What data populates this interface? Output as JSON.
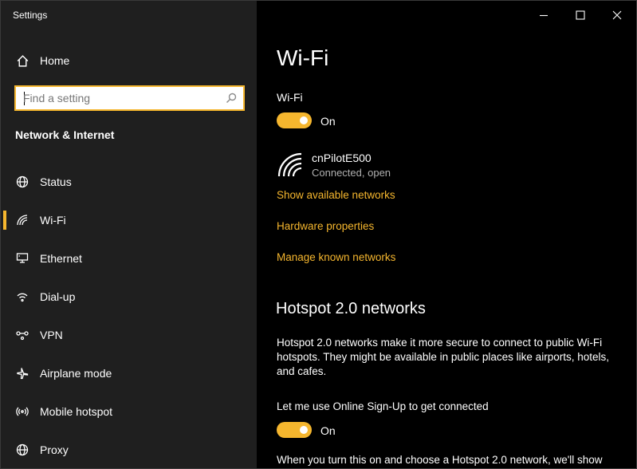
{
  "window": {
    "title": "Settings"
  },
  "sidebar": {
    "home_label": "Home",
    "search_placeholder": "Find a setting",
    "section_title": "Network & Internet",
    "items": [
      {
        "label": "Status",
        "icon": "globe-icon"
      },
      {
        "label": "Wi-Fi",
        "icon": "wifi-icon",
        "active": true
      },
      {
        "label": "Ethernet",
        "icon": "ethernet-icon"
      },
      {
        "label": "Dial-up",
        "icon": "dialup-icon"
      },
      {
        "label": "VPN",
        "icon": "vpn-icon"
      },
      {
        "label": "Airplane mode",
        "icon": "airplane-icon"
      },
      {
        "label": "Mobile hotspot",
        "icon": "hotspot-icon"
      },
      {
        "label": "Proxy",
        "icon": "proxy-icon"
      }
    ]
  },
  "main": {
    "page_title": "Wi-Fi",
    "wifi_label": "Wi-Fi",
    "wifi_toggle_state": "On",
    "network": {
      "name": "cnPilotE500",
      "status": "Connected, open"
    },
    "links": {
      "show_networks": "Show available networks",
      "hardware": "Hardware properties",
      "manage": "Manage known networks"
    },
    "hotspot": {
      "heading": "Hotspot 2.0 networks",
      "description": "Hotspot 2.0 networks make it more secure to connect to public Wi-Fi hotspots. They might be available in public places like airports, hotels, and cafes.",
      "osu_label": "Let me use Online Sign-Up to get connected",
      "osu_toggle_state": "On",
      "bottom_text": "When you turn this on and choose a Hotspot 2.0 network, we'll show"
    }
  },
  "colors": {
    "accent": "#f5b62e",
    "sidebar_bg": "#1f1f1f",
    "main_bg": "#000000"
  }
}
